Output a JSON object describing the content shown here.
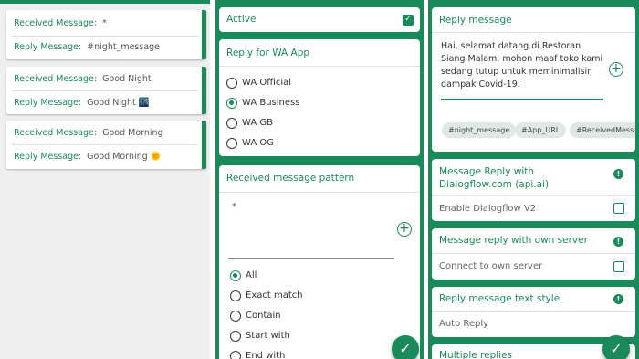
{
  "messages": [
    {
      "received_label": "Received Message:",
      "received_value": "*",
      "reply_label": "Reply Message:",
      "reply_value": "#night_message"
    },
    {
      "received_label": "Received Message:",
      "received_value": "Good Night",
      "reply_label": "Reply Message:",
      "reply_value": "Good Night 🌃"
    },
    {
      "received_label": "Received Message:",
      "received_value": "Good Morning",
      "reply_label": "Reply Message:",
      "reply_value": "Good Morning 🌞"
    }
  ],
  "rule": {
    "active_label": "Active",
    "reply_for_title": "Reply for WA App",
    "apps": [
      "WA Official",
      "WA Business",
      "WA GB",
      "WA OG"
    ],
    "selected_app": "WA Business",
    "pattern_title": "Received message pattern",
    "pattern_value": "*",
    "match_options": [
      "All",
      "Exact match",
      "Contain",
      "Start with",
      "End with"
    ],
    "selected_match": "All"
  },
  "reply": {
    "title": "Reply message",
    "text": "Hai, selamat datang di Restoran Siang Malam, mohon maaf toko kami sedang tutup untuk meminimalisir dampak Covid-19.",
    "chips": [
      "#night_message",
      "#App_URL",
      "#ReceivedMess"
    ],
    "dialogflow_title": "Message Reply with Dialogflow.com (api.ai)",
    "dialogflow_option": "Enable Dialogflow V2",
    "server_title": "Message reply with own server",
    "server_option": "Connect to own server",
    "style_title": "Reply message text style",
    "style_value": "Auto Reply",
    "multiple_title": "Multiple replies"
  },
  "icons": {
    "confirm": "check-icon",
    "add": "plus-circle-icon",
    "alert": "exclamation-icon"
  },
  "colors": {
    "accent": "#1b8a5a",
    "chip_bg": "#dfe9e4"
  }
}
